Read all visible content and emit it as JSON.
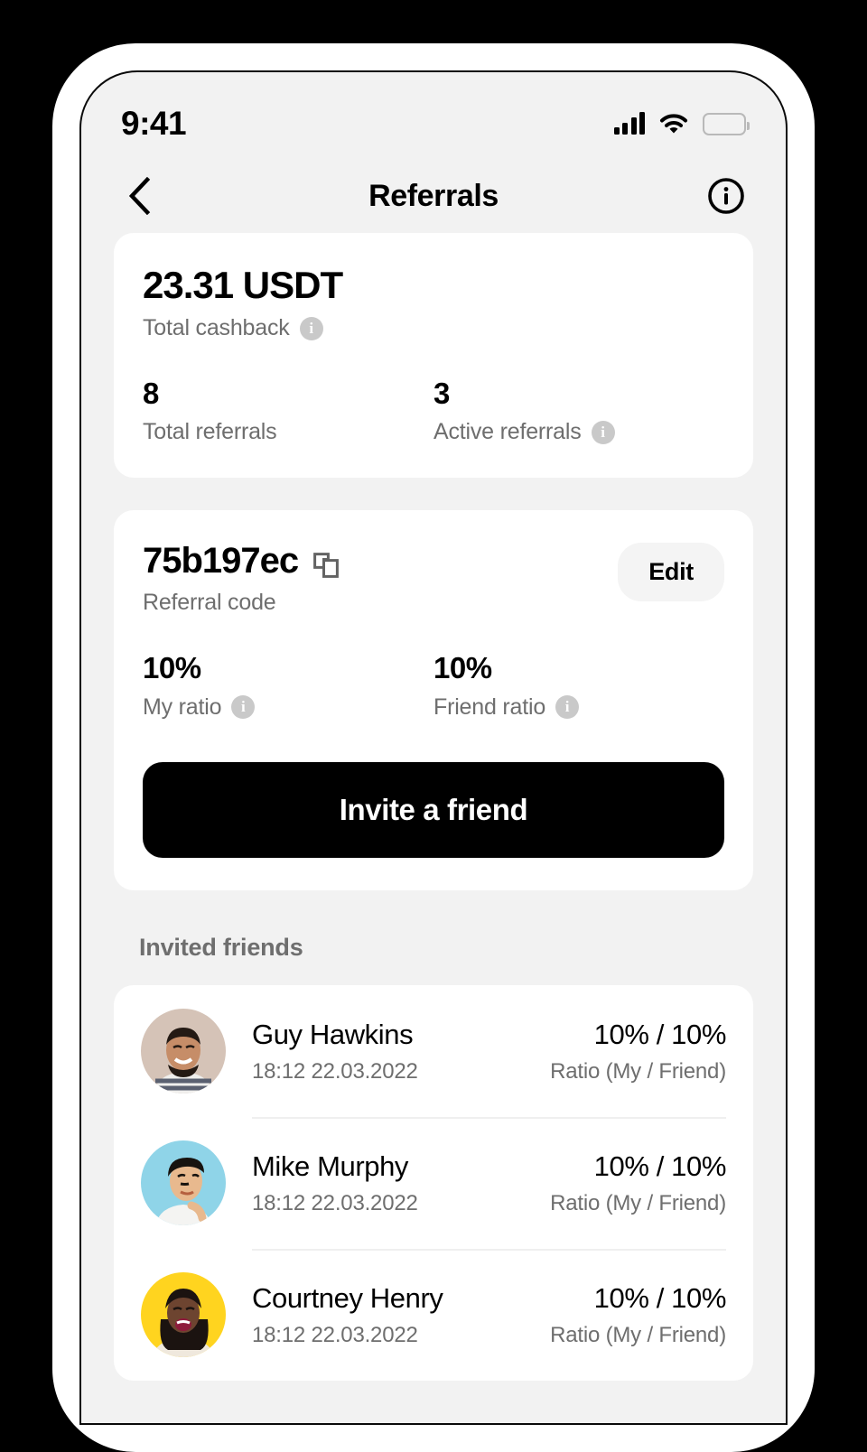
{
  "status_bar": {
    "time": "9:41",
    "signal_icon": "signal-bars-icon",
    "wifi_icon": "wifi-icon",
    "battery_icon": "battery-full-icon"
  },
  "nav": {
    "back_icon": "chevron-left-icon",
    "title": "Referrals",
    "info_icon": "info-circle-icon"
  },
  "cashback_card": {
    "amount": "23.31 USDT",
    "amount_label": "Total cashback",
    "total_referrals_value": "8",
    "total_referrals_label": "Total referrals",
    "active_referrals_value": "3",
    "active_referrals_label": "Active referrals"
  },
  "referral_card": {
    "code": "75b197ec",
    "copy_icon": "copy-icon",
    "code_label": "Referral code",
    "edit_label": "Edit",
    "my_ratio_value": "10%",
    "my_ratio_label": "My ratio",
    "friend_ratio_value": "10%",
    "friend_ratio_label": "Friend ratio",
    "invite_label": "Invite a friend"
  },
  "invited_friends": {
    "section_title": "Invited friends",
    "rows": [
      {
        "name": "Guy Hawkins",
        "date": "18:12 22.03.2022",
        "ratio": "10% / 10%",
        "ratio_label": "Ratio (My / Friend)",
        "avatar_bg": "#d5c3b7"
      },
      {
        "name": "Mike Murphy",
        "date": "18:12 22.03.2022",
        "ratio": "10% / 10%",
        "ratio_label": "Ratio (My / Friend)",
        "avatar_bg": "#8fd4e8"
      },
      {
        "name": "Courtney Henry",
        "date": "18:12 22.03.2022",
        "ratio": "10% / 10%",
        "ratio_label": "Ratio (My / Friend)",
        "avatar_bg": "#ffd41f"
      }
    ]
  },
  "colors": {
    "screen_bg": "#f2f2f2",
    "card_bg": "#ffffff",
    "primary": "#000000",
    "muted_text": "#6e6e6e",
    "chip_bg": "#f4f4f4",
    "info_dot": "#c9c9c9",
    "divider": "#efefef"
  }
}
